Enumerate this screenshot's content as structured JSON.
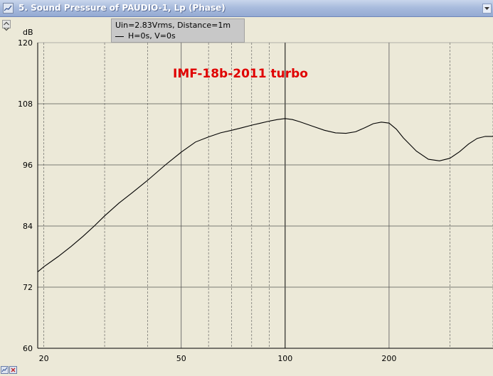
{
  "window": {
    "title": "5. Sound Pressure of PAUDIO-1, Lp (Phase)"
  },
  "legend": {
    "line1": "Uin=2.83Vrms, Distance=1m",
    "line2": "H=0s, V=0s"
  },
  "icons": {
    "window_icon": "chart-window-icon",
    "dropdown": "dropdown-arrow-icon",
    "scroll_up": "scroll-up-icon",
    "scroll_down": "scroll-down-icon",
    "bottom_left": "toolbar-grid-icon",
    "bottom_right": "toolbar-close-icon"
  },
  "colors": {
    "curve": "#000000",
    "annotation": "#e00000",
    "plot_bg": "#ECE9D8"
  },
  "chart_data": {
    "type": "line",
    "title": "",
    "ylabel": "dB",
    "xlabel": "",
    "xscale": "log",
    "xlim": [
      19.2,
      400
    ],
    "ylim": [
      60,
      120
    ],
    "yticks": [
      60,
      72,
      84,
      96,
      108,
      120
    ],
    "xtick_labels": [
      "20",
      "50",
      "100",
      "200"
    ],
    "annotation": "IMF-18b-2011 turbo",
    "grid": true,
    "series": [
      {
        "x": [
          19.2,
          20,
          22,
          24,
          26,
          28,
          30,
          33,
          36,
          40,
          45,
          50,
          55,
          60,
          65,
          70,
          75,
          80,
          85,
          90,
          95,
          100,
          105,
          110,
          120,
          130,
          140,
          150,
          160,
          170,
          180,
          190,
          200,
          210,
          220,
          240,
          260,
          280,
          300,
          320,
          340,
          360,
          380,
          400
        ],
        "y": [
          75,
          76,
          78,
          80,
          82,
          84,
          86,
          88.5,
          90.5,
          93,
          96,
          98.5,
          100.5,
          101.5,
          102.3,
          102.8,
          103.3,
          103.8,
          104.2,
          104.6,
          104.9,
          105.1,
          104.9,
          104.5,
          103.6,
          102.8,
          102.3,
          102.2,
          102.5,
          103.3,
          104.1,
          104.4,
          104.2,
          103,
          101.3,
          98.7,
          97.1,
          96.8,
          97.3,
          98.6,
          100.1,
          101.2,
          101.6,
          101.6
        ]
      }
    ]
  }
}
